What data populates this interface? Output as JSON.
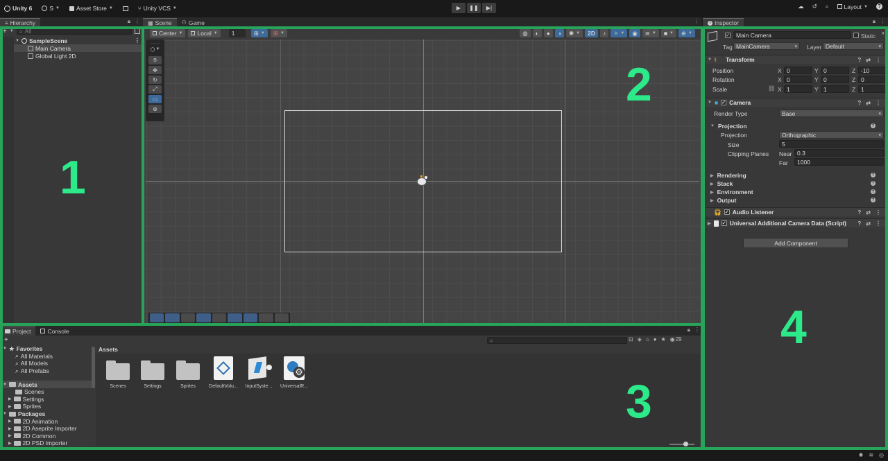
{
  "toolbar": {
    "app_name": "Unity 6",
    "account": "S",
    "asset_store": "Asset Store",
    "vcs": "Unity VCS",
    "layout": "Layout"
  },
  "hierarchy": {
    "tab": "Hierarchy",
    "search_placeholder": "All",
    "scene": "SampleScene",
    "items": [
      "Main Camera",
      "Global Light 2D"
    ]
  },
  "scene": {
    "tabs": [
      "Scene",
      "Game"
    ],
    "pivot": "Center",
    "space": "Local",
    "grid_step": "1",
    "mode_2d": "2D"
  },
  "inspector": {
    "tab": "Inspector",
    "object_name": "Main Camera",
    "static_label": "Static",
    "tag_label": "Tag",
    "tag_value": "MainCamera",
    "layer_label": "Layer",
    "layer_value": "Default",
    "transform": {
      "title": "Transform",
      "position_label": "Position",
      "rotation_label": "Rotation",
      "scale_label": "Scale",
      "axis_x": "X",
      "axis_y": "Y",
      "axis_z": "Z",
      "position": [
        "0",
        "0",
        "-10"
      ],
      "rotation": [
        "0",
        "0",
        "0"
      ],
      "scale": [
        "1",
        "1",
        "1"
      ]
    },
    "camera": {
      "title": "Camera",
      "render_type_label": "Render Type",
      "render_type": "Base",
      "projection_section": "Projection",
      "projection_label": "Projection",
      "projection_value": "Orthographic",
      "size_label": "Size",
      "size_value": "5",
      "clipping_label": "Clipping Planes",
      "near_label": "Near",
      "near_value": "0.3",
      "far_label": "Far",
      "far_value": "1000",
      "sections": [
        "Rendering",
        "Stack",
        "Environment",
        "Output"
      ]
    },
    "audio_listener": "Audio Listener",
    "universal_data": "Universal Additional Camera Data (Script)",
    "add_component": "Add Component"
  },
  "project": {
    "tabs": [
      "Project",
      "Console"
    ],
    "favorites": "Favorites",
    "favorite_items": [
      "All Materials",
      "All Models",
      "All Prefabs"
    ],
    "assets_root": "Assets",
    "asset_folders": [
      "Scenes",
      "Settings",
      "Sprites"
    ],
    "packages_root": "Packages",
    "packages": [
      "2D Animation",
      "2D Aseprite Importer",
      "2D Common",
      "2D PSD Importer"
    ],
    "breadcrumb": "Assets",
    "hidden_count": "29",
    "grid_items": [
      "Scenes",
      "Settings",
      "Sprites",
      "DefaultVolu...",
      "InputSyste...",
      "UniversalR..."
    ]
  },
  "regions": [
    "1",
    "2",
    "3",
    "4"
  ],
  "colors": {
    "region_outline": "#27a35a",
    "region_number": "#2ce98a",
    "panel_bg": "#383838",
    "accent_blue": "#3d6a9a"
  }
}
